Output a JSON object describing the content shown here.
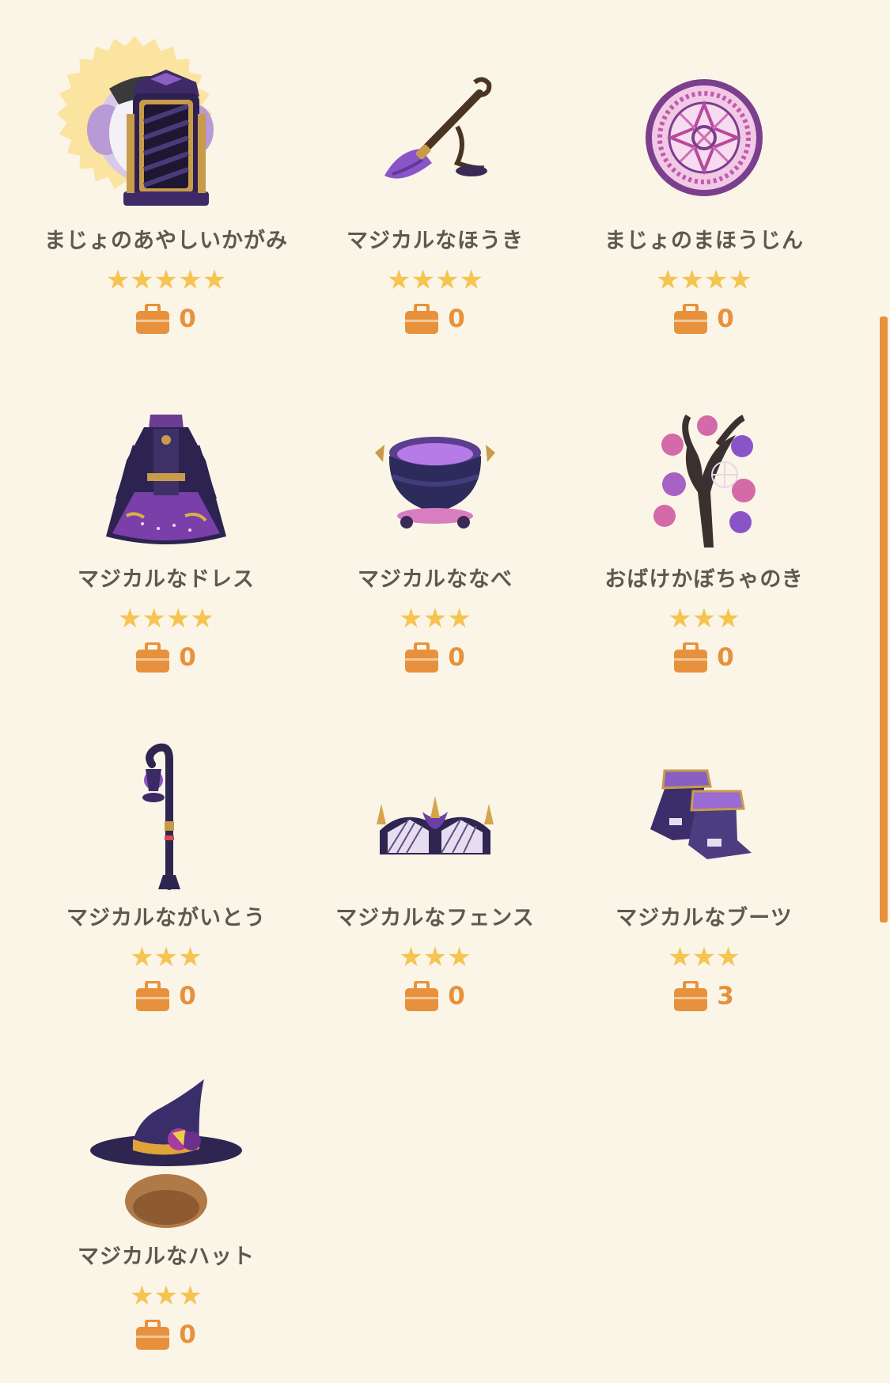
{
  "items": [
    {
      "name": "まじょのあやしいかがみ",
      "stars": 5,
      "count": "0",
      "highlighted": true,
      "icon": "witch-mirror-icon"
    },
    {
      "name": "マジカルなほうき",
      "stars": 4,
      "count": "0",
      "icon": "magic-broom-icon"
    },
    {
      "name": "まじょのまほうじん",
      "stars": 4,
      "count": "0",
      "icon": "magic-circle-icon"
    },
    {
      "name": "マジカルなドレス",
      "stars": 4,
      "count": "0",
      "icon": "magic-dress-icon"
    },
    {
      "name": "マジカルななべ",
      "stars": 3,
      "count": "0",
      "icon": "magic-cauldron-icon"
    },
    {
      "name": "おばけかぼちゃのき",
      "stars": 3,
      "count": "0",
      "icon": "ghost-pumpkin-tree-icon"
    },
    {
      "name": "マジカルながいとう",
      "stars": 3,
      "count": "0",
      "icon": "magic-streetlamp-icon"
    },
    {
      "name": "マジカルなフェンス",
      "stars": 3,
      "count": "0",
      "icon": "magic-fence-icon"
    },
    {
      "name": "マジカルなブーツ",
      "stars": 3,
      "count": "3",
      "icon": "magic-boots-icon"
    },
    {
      "name": "マジカルなハット",
      "stars": 3,
      "count": "0",
      "icon": "magic-hat-icon"
    }
  ],
  "colors": {
    "background": "#fbf5e7",
    "star": "#f5c451",
    "accent": "#e8913c",
    "text": "#5f5750",
    "highlight": "#fbe3a0"
  }
}
